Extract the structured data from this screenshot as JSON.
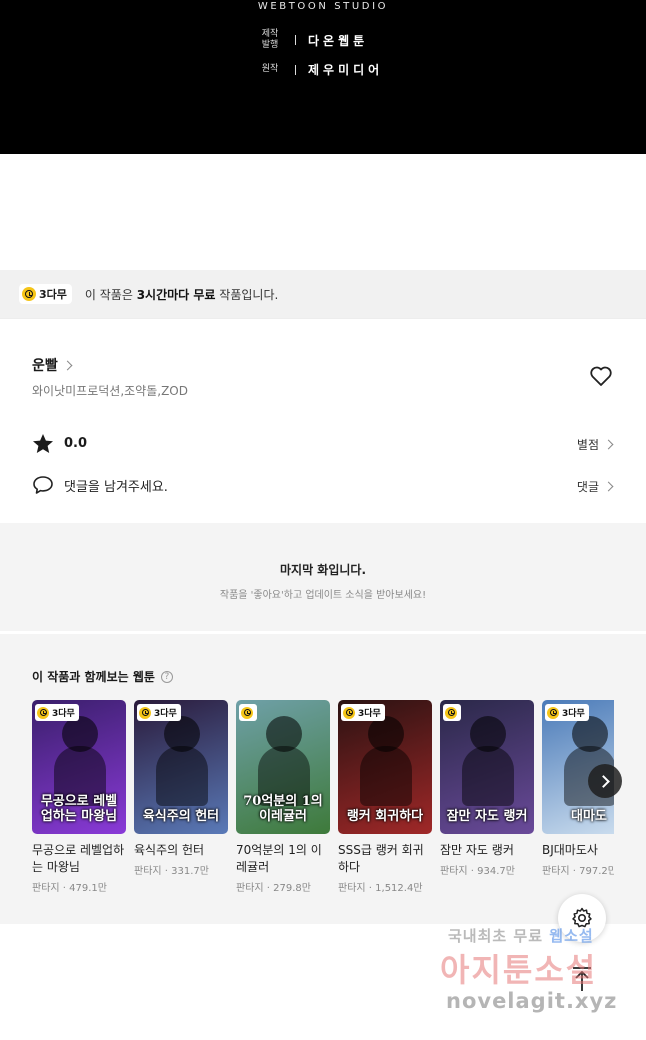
{
  "banner": {
    "studio": "WEBTOON STUDIO",
    "credits": [
      {
        "label": "제작\n발행",
        "value": "다온웹툰"
      },
      {
        "label": "원작",
        "value": "제우미디어"
      }
    ]
  },
  "free_notice": {
    "badge": "3다무",
    "text_before": "이 작품은 ",
    "text_bold": "3시간마다 무료",
    "text_after": " 작품입니다."
  },
  "info": {
    "title": "운빨",
    "authors": "와이낫미프로덕션,조약돌,ZOD",
    "rating": "0.0",
    "rating_link": "별점",
    "comment_prompt": "댓글을 남겨주세요.",
    "comment_link": "댓글"
  },
  "last_episode": {
    "title": "마지막 화입니다.",
    "subtitle": "작품을 '좋아요'하고 업데이트 소식을 받아보세요!"
  },
  "recommend": {
    "heading": "이 작품과 함께보는 웹툰",
    "help": "?",
    "cards": [
      {
        "badge": "3다무",
        "title": "무공으로 레벨업하는 마왕님",
        "cover_text": "무공으로 레벨업하는 마왕님",
        "genre": "판타지",
        "views": "479.1만",
        "color1": "#3a1f6b",
        "color2": "#8a3ad8"
      },
      {
        "badge": "3다무",
        "title": "육식주의 헌터",
        "cover_text": "육식주의 헌터",
        "genre": "판타지",
        "views": "331.7만",
        "color1": "#2a1a3a",
        "color2": "#5a7ab8"
      },
      {
        "badge": "",
        "title": "70억분의 1의 이레귤러",
        "cover_text": "70억분의 1의 이레귤러",
        "genre": "판타지",
        "views": "279.8만",
        "color1": "#6fa0a8",
        "color2": "#3e7a3a"
      },
      {
        "badge": "3다무",
        "title": "SSS급 랭커 회귀하다",
        "cover_text": "랭커 회귀하다",
        "genre": "판타지",
        "views": "1,512.4만",
        "color1": "#2a1212",
        "color2": "#a02828"
      },
      {
        "badge": "",
        "title": "잠만 자도 랭커",
        "cover_text": "잠만 자도 랭커",
        "genre": "판타지",
        "views": "934.7만",
        "color1": "#2a2848",
        "color2": "#6a4a9a"
      },
      {
        "badge": "3다무",
        "title": "BJ대마도사",
        "cover_text": "대마도",
        "genre": "판타지",
        "views": "797.2만",
        "color1": "#4a7ab8",
        "color2": "#cfe0f0"
      }
    ]
  },
  "watermark": {
    "line1_a": "국내최초 무료",
    "line1_b": "웹소설",
    "line2": "아지툰소설",
    "line3": "novelagit.xyz"
  },
  "colors": {
    "badge_yellow": "#f5c518",
    "section_gray": "#f4f4f4"
  },
  "icons": [
    "clock-icon",
    "chevron-right-icon",
    "heart-icon",
    "star-icon",
    "speech-bubble-icon",
    "question-icon",
    "gear-icon",
    "arrow-up-icon"
  ]
}
